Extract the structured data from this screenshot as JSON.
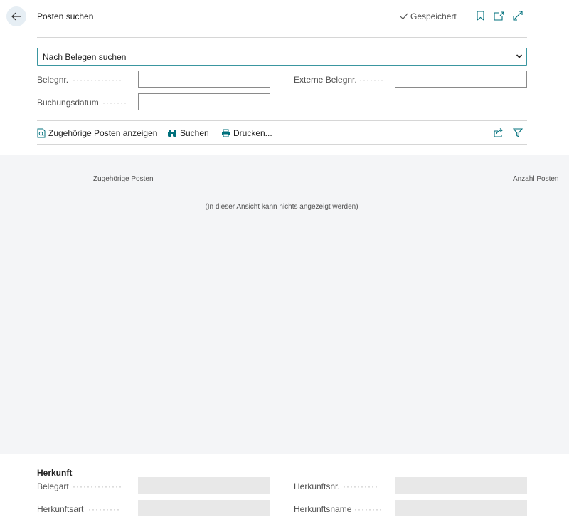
{
  "header": {
    "title": "Posten suchen",
    "saved_label": "Gespeichert"
  },
  "search_mode": {
    "selected": "Nach Belegen suchen"
  },
  "filters": {
    "belegnr_label": "Belegnr.",
    "belegnr_value": "",
    "externe_belegnr_label": "Externe Belegnr.",
    "externe_belegnr_value": "",
    "buchungsdatum_label": "Buchungsdatum",
    "buchungsdatum_value": ""
  },
  "actions": {
    "show_related": "Zugehörige Posten anzeigen",
    "search": "Suchen",
    "print": "Drucken..."
  },
  "list": {
    "columns": [
      "Zugehörige Posten",
      "Anzahl Posten"
    ],
    "empty_message": "(In dieser Ansicht kann nichts angezeigt werden)"
  },
  "origin": {
    "title": "Herkunft",
    "belegart_label": "Belegart",
    "herkunftsart_label": "Herkunftsart",
    "herkunftsnr_label": "Herkunftsnr.",
    "herkunftsname_label": "Herkunftsname"
  },
  "colors": {
    "accent": "#00707c",
    "select_border": "#3a96a0",
    "list_background": "#f4f5f7"
  }
}
